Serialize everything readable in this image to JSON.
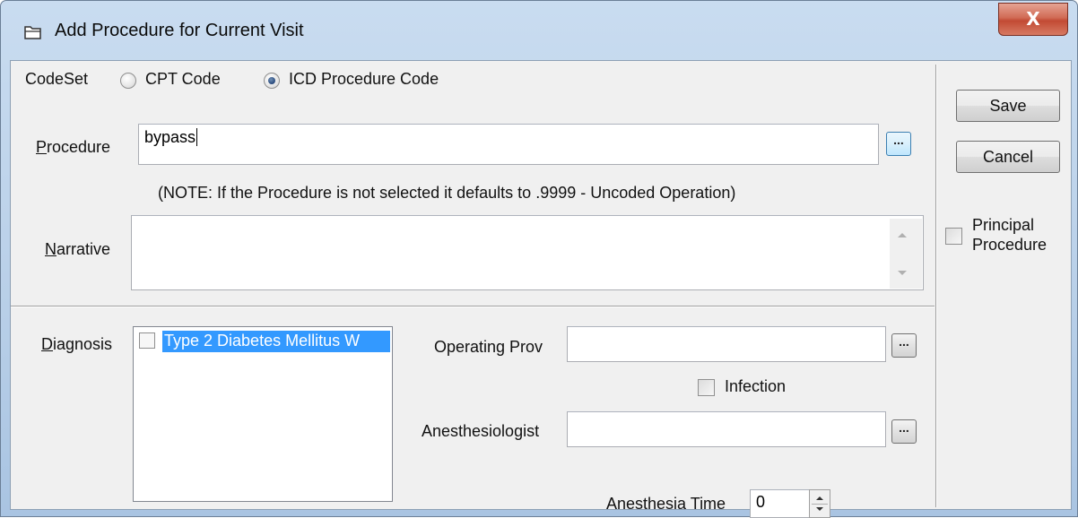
{
  "window": {
    "title": "Add Procedure for Current Visit",
    "close_symbol": "X",
    "title_icon": "folder-icon"
  },
  "codeset": {
    "label": "CodeSet",
    "options": [
      {
        "label": "CPT Code",
        "selected": false
      },
      {
        "label": "ICD Procedure Code",
        "selected": true
      }
    ]
  },
  "procedure": {
    "label_first": "P",
    "label_rest": "rocedure",
    "value": "bypass",
    "browse_label": "..."
  },
  "note": "(NOTE: If the Procedure is not selected it defaults to .9999 - Uncoded Operation)",
  "narrative": {
    "label_first": "N",
    "label_rest": "arrative",
    "value": ""
  },
  "diagnosis": {
    "label_first": "D",
    "label_rest": "iagnosis",
    "items": [
      {
        "label": "Type 2 Diabetes Mellitus W",
        "checked": false,
        "selected": true
      }
    ]
  },
  "operating_prov": {
    "label": "Operating Prov",
    "value": "",
    "browse_label": "..."
  },
  "infection": {
    "label": "Infection",
    "checked": false
  },
  "anesthesiologist": {
    "label": "Anesthesiologist",
    "value": "",
    "browse_label": "..."
  },
  "anesthesia_time": {
    "label": "Anesthesia Time",
    "value": "0"
  },
  "actions": {
    "save_label": "Save",
    "cancel_label": "Cancel"
  },
  "principal_procedure": {
    "line1": "Principal",
    "line2": "Procedure",
    "checked": false
  },
  "colors": {
    "selection": "#3399ff",
    "window_frame": "#b8cfe8",
    "close_button": "#c24a34"
  }
}
